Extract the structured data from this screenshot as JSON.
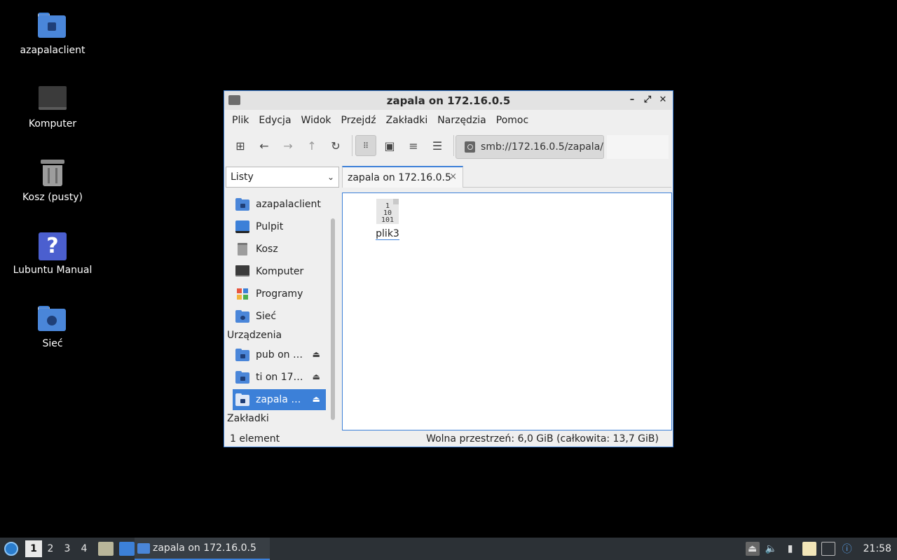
{
  "desktop": {
    "icons": [
      {
        "label": "azapalaclient",
        "icon": "home-folder-icon"
      },
      {
        "label": "Komputer",
        "icon": "computer-icon"
      },
      {
        "label": "Kosz (pusty)",
        "icon": "trash-icon"
      },
      {
        "label": "Lubuntu Manual",
        "icon": "help-icon"
      },
      {
        "label": "Sieć",
        "icon": "network-folder-icon"
      }
    ]
  },
  "window": {
    "title": "zapala on 172.16.0.5",
    "controls": {
      "minimize": "–",
      "maximize": "⤢",
      "close": "✕"
    },
    "menu": [
      "Plik",
      "Edycja",
      "Widok",
      "Przejdź",
      "Zakładki",
      "Narzędzia",
      "Pomoc"
    ],
    "toolbar": {
      "location": "smb://172.16.0.5/zapala/"
    },
    "side_pane_mode": "Listy",
    "tab": {
      "label": "zapala on 172.16.0.5",
      "close": "×"
    },
    "places": [
      {
        "label": "azapalaclient",
        "icon": "home-folder-icon"
      },
      {
        "label": "Pulpit",
        "icon": "desktop-icon"
      },
      {
        "label": "Kosz",
        "icon": "trash-icon"
      },
      {
        "label": "Komputer",
        "icon": "computer-icon"
      },
      {
        "label": "Programy",
        "icon": "applications-icon"
      },
      {
        "label": "Sieć",
        "icon": "network-folder-icon"
      }
    ],
    "devices_heading": "Urządzenia",
    "devices": [
      {
        "label": "pub on …",
        "eject": "⏏"
      },
      {
        "label": "ti on 17…",
        "eject": "⏏"
      },
      {
        "label": "zapala …",
        "eject": "⏏",
        "selected": true
      }
    ],
    "bookmarks_heading": "Zakładki",
    "files": [
      {
        "name": "plik3",
        "icon": "binary-file-icon",
        "glyph_lines": [
          "1",
          "10",
          "101"
        ]
      }
    ],
    "status": {
      "count": "1 element",
      "free_space": "Wolna przestrzeń: 6,0 GiB (całkowita: 13,7 GiB)"
    }
  },
  "taskbar": {
    "workspaces": [
      "1",
      "2",
      "3",
      "4"
    ],
    "active_workspace": "1",
    "task_label": "zapala on 172.16.0.5",
    "clock": "21:58"
  },
  "colors": {
    "accent": "#3c80d8",
    "folder": "#4a86d9",
    "taskbar": "#2c3136"
  }
}
